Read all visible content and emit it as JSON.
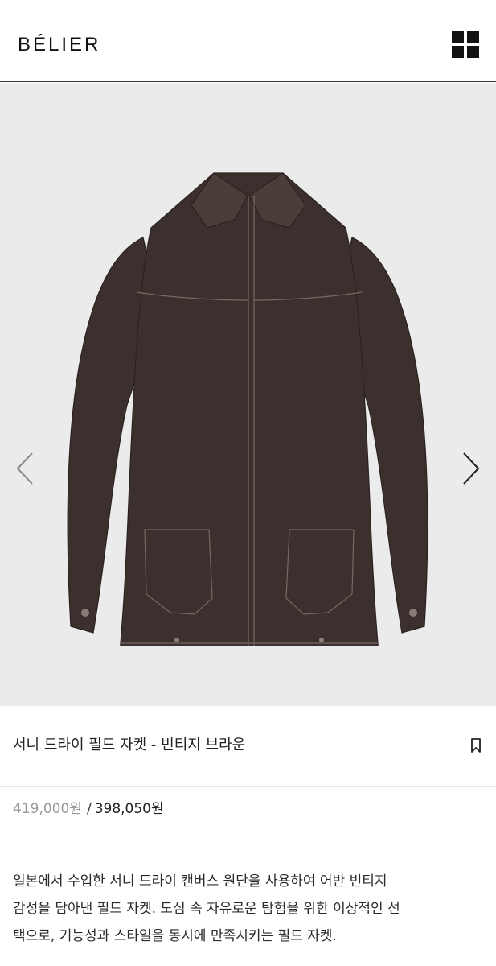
{
  "header": {
    "logo_text": "BÉLIER",
    "menu_icon": "grid-menu-icon"
  },
  "gallery": {
    "prev_icon": "chevron-left-icon",
    "next_icon": "chevron-right-icon",
    "background_color": "#ecebeb",
    "product_color": "#3b302d"
  },
  "product": {
    "title": "서니 드라이 필드 자켓 - 빈티지 브라운",
    "bookmark_icon": "bookmark-icon",
    "original_price": "419,000원",
    "price_separator": "/",
    "sale_price": "398,050원",
    "description_lines": [
      "일본에서 수입한 서니 드라이 캔버스 원단을 사용하여 어반 빈티지",
      "감성을 담아낸 필드 자켓. 도심 속 자유로운 탐험을 위한 이상적인 선",
      "택으로, 기능성과 스타일을 동시에 만족시키는 필드 자켓."
    ]
  }
}
